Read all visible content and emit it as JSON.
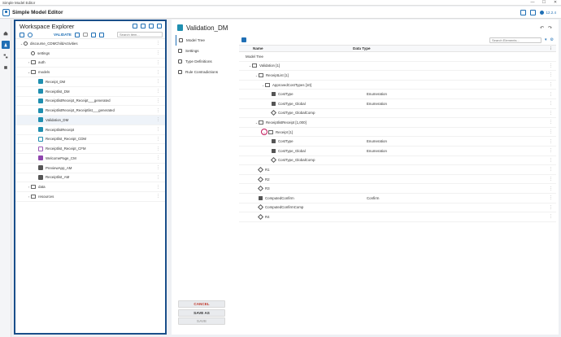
{
  "window": {
    "title": "Simple Model Editor",
    "controls": [
      "—",
      "☐",
      "✕"
    ]
  },
  "app": {
    "title": "Simple Model Editor",
    "version": "12.2.4"
  },
  "explorer": {
    "title": "Workspace Explorer",
    "validate_label": "VALIDATE",
    "search_placeholder": "Search item...",
    "items": [
      {
        "label": "discourse_CDMChildActivities",
        "depth": 0,
        "chev": "⌄",
        "icon": "project"
      },
      {
        "label": "settings",
        "depth": 1,
        "chev": "",
        "icon": "gear"
      },
      {
        "label": "auth",
        "depth": 1,
        "chev": "›",
        "icon": "folder"
      },
      {
        "label": "models",
        "depth": 1,
        "chev": "⌄",
        "icon": "folder"
      },
      {
        "label": "Receipt_DM",
        "depth": 2,
        "chev": "",
        "icon": "dm"
      },
      {
        "label": "Receiptlist_DM",
        "depth": 2,
        "chev": "",
        "icon": "dm"
      },
      {
        "label": "ReceiptlistReceipt_Receipt___generated",
        "depth": 2,
        "chev": "",
        "icon": "dm"
      },
      {
        "label": "ReceiptlistReceipt_Receiptlist___generated",
        "depth": 2,
        "chev": "",
        "icon": "dm"
      },
      {
        "label": "Validation_DM",
        "depth": 2,
        "chev": "",
        "icon": "dm",
        "selected": true
      },
      {
        "label": "ReceiptlistReceipt",
        "depth": 2,
        "chev": "",
        "icon": "dm"
      },
      {
        "label": "Receiptlist_Receipt_CDM",
        "depth": 2,
        "chev": "",
        "icon": "cdm"
      },
      {
        "label": "Receiptlist_Receipt_CFM",
        "depth": 2,
        "chev": "",
        "icon": "cfm"
      },
      {
        "label": "WelcomePage_CM",
        "depth": 2,
        "chev": "",
        "icon": "cm"
      },
      {
        "label": "PreviewApp_AM",
        "depth": 2,
        "chev": "",
        "icon": "am"
      },
      {
        "label": "Receiptlist_AM",
        "depth": 2,
        "chev": "",
        "icon": "am"
      },
      {
        "label": "data",
        "depth": 1,
        "chev": "›",
        "icon": "folder"
      },
      {
        "label": "resources",
        "depth": 1,
        "chev": "›",
        "icon": "folder"
      }
    ]
  },
  "document": {
    "title": "Validation_DM"
  },
  "side_tabs": [
    {
      "label": "Model Tree",
      "active": true
    },
    {
      "label": "Settings"
    },
    {
      "label": "Type Definitions"
    },
    {
      "label": "Rule Contradictions"
    }
  ],
  "actions": {
    "cancel": "CANCEL",
    "save_as": "SAVE AS",
    "save": "SAVE"
  },
  "grid": {
    "search_placeholder": "Search Elements...",
    "col_name": "Name",
    "col_type": "Data Type",
    "rows": [
      {
        "name": "Model Tree",
        "type": "",
        "depth": 0,
        "chev": "",
        "icon": "none"
      },
      {
        "name": "Validation [1]",
        "type": "",
        "depth": 1,
        "chev": "⌄",
        "icon": "folder"
      },
      {
        "name": "ReceiptList [1]",
        "type": "",
        "depth": 2,
        "chev": "⌄",
        "icon": "folder"
      },
      {
        "name": "ApprovedCostTypes [10]",
        "type": "",
        "depth": 3,
        "chev": "⌄",
        "icon": "folder"
      },
      {
        "name": "CostType",
        "type": "Enumeration",
        "depth": 4,
        "chev": "",
        "icon": "attr"
      },
      {
        "name": "CostType_Global",
        "type": "Enumeration",
        "depth": 4,
        "chev": "",
        "icon": "attr"
      },
      {
        "name": "CostType_GlobalComp",
        "type": "",
        "depth": 4,
        "chev": "",
        "icon": "gc"
      },
      {
        "name": "ReceiptlistReceipt [1,000]",
        "type": "",
        "depth": 2,
        "chev": "⌄",
        "icon": "folder"
      },
      {
        "name": "Receipt [1]",
        "type": "",
        "depth": 3,
        "chev": "",
        "icon": "folder",
        "marked": true
      },
      {
        "name": "CostType",
        "type": "Enumeration",
        "depth": 4,
        "chev": "",
        "icon": "attr"
      },
      {
        "name": "CostType_Global",
        "type": "Enumeration",
        "depth": 4,
        "chev": "",
        "icon": "attr"
      },
      {
        "name": "CostType_GlobalComp",
        "type": "",
        "depth": 4,
        "chev": "",
        "icon": "gc"
      },
      {
        "name": "R1",
        "type": "",
        "depth": 2,
        "chev": "",
        "icon": "gc"
      },
      {
        "name": "R2",
        "type": "",
        "depth": 2,
        "chev": "",
        "icon": "gc"
      },
      {
        "name": "R3",
        "type": "",
        "depth": 2,
        "chev": "",
        "icon": "gc"
      },
      {
        "name": "ComputedConfirm",
        "type": "Confirm",
        "depth": 2,
        "chev": "",
        "icon": "attr"
      },
      {
        "name": "ComputedConfirmComp",
        "type": "",
        "depth": 2,
        "chev": "",
        "icon": "gc"
      },
      {
        "name": "R4",
        "type": "",
        "depth": 2,
        "chev": "",
        "icon": "gc"
      }
    ]
  },
  "colors": {
    "accent": "#1f6fb5",
    "border_highlight": "#1a4f8a",
    "cancel": "#c0392b",
    "marker": "#c2185b"
  }
}
